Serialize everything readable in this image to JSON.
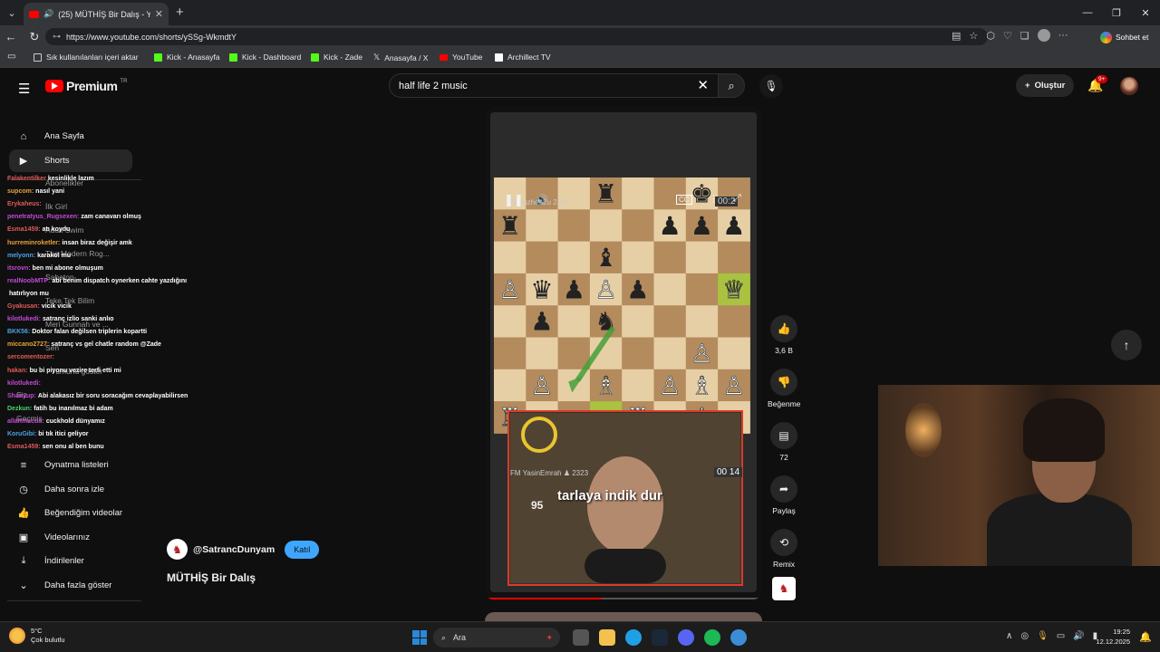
{
  "browser": {
    "tab_title": "(25) MÜTHİŞ Bir Dalış - YouTu",
    "url": "https://www.youtube.com/shorts/ySSg-WkmdtY",
    "chat_button": "Sohbet et",
    "bookmarks": [
      "Sık kullanılanları içeri aktar",
      "Kick - Anasayfa",
      "Kick - Dashboard",
      "Kick - Zade",
      "Anasayfa / X",
      "YouTube",
      "Archillect TV"
    ]
  },
  "youtube": {
    "logo_text": "Premium",
    "logo_region": "TR",
    "search_value": "half life 2 music",
    "create_label": "Oluştur",
    "notif_count": "9+"
  },
  "sidebar": {
    "top_items": [
      {
        "label": "Ana Sayfa",
        "icon": "home-icon"
      },
      {
        "label": "Shorts",
        "icon": "shorts-icon"
      }
    ],
    "behind_items": [
      "Abonelikler",
      "İlk Girl",
      "Adult Swim",
      "The Modern Rog...",
      "Sabaton",
      "Teke Tek Bilim",
      "Meri Gunnah ve ...",
      "Sen",
      "Tümünü göster",
      "Siz",
      "Geçmiş"
    ],
    "bottom_items": [
      {
        "label": "Oynatma listeleri",
        "icon": "playlist-icon"
      },
      {
        "label": "Daha sonra izle",
        "icon": "clock-icon"
      },
      {
        "label": "Beğendiğim videolar",
        "icon": "like-icon"
      },
      {
        "label": "Videolarınız",
        "icon": "video-icon"
      },
      {
        "label": "İndirilenler",
        "icon": "download-icon"
      },
      {
        "label": "Daha fazla göster",
        "icon": "chevron-down-icon"
      }
    ]
  },
  "chat_overlay": [
    {
      "user": "Falakentilker",
      "msg": "kesinlikle lazım",
      "color": "#e05a5a"
    },
    {
      "user": "supcom:",
      "msg": "nasıl yani",
      "color": "#e8a33a"
    },
    {
      "user": "Erykaheus:",
      "msg": "",
      "color": "#e05a5a"
    },
    {
      "user": "penetratyus_Rugsexen:",
      "msg": "zam canavarı olmuş",
      "color": "#c24ad6"
    },
    {
      "user": "Esma1459:",
      "msg": "atı koydu",
      "color": "#e05a5a"
    },
    {
      "user": "hurreminroketler:",
      "msg": "insan biraz değişir amk",
      "color": "#e8a33a"
    },
    {
      "user": "melyonn:",
      "msg": "karakol mu",
      "color": "#4aa3e8"
    },
    {
      "user": "itsrovn:",
      "msg": "ben mi abone olmuşum",
      "color": "#c24ad6"
    },
    {
      "user": "realNoobMTP:",
      "msg": "abi benim dispatch oynerken cahte yazdığını",
      "color": "#c24ad6"
    },
    {
      "user": "",
      "msg": "hatırlıyon mu",
      "color": "#ffffff"
    },
    {
      "user": "Gyakusan:",
      "msg": "vicik vicik",
      "color": "#e05a5a"
    },
    {
      "user": "kilotlukedi:",
      "msg": "satranç izlio sanki anlıo",
      "color": "#c24ad6"
    },
    {
      "user": "BKK56:",
      "msg": "Doktor falan değilsen triplerin kopartti",
      "color": "#4aa3e8"
    },
    {
      "user": "miccano2727:",
      "msg": "satranç vs gel chatle random @Zade",
      "color": "#e8a33a"
    },
    {
      "user": "sercomentozer:",
      "msg": "",
      "color": "#e05a5a"
    },
    {
      "user": "hakan:",
      "msg": "bu bi piyonu vezire terfi etti mi",
      "color": "#e05a5a"
    },
    {
      "user": "kilotlukedi:",
      "msg": "",
      "color": "#c24ad6"
    },
    {
      "user": "Shanyup:",
      "msg": "Abi alakasız bir soru soracağım cevaplayabilirsen",
      "color": "#c24ad6"
    },
    {
      "user": "Dezkun:",
      "msg": "fatih bu inanılmaz bi adam",
      "color": "#4ad66a"
    },
    {
      "user": "allahmacun:",
      "msg": "cuckhold dünyamız",
      "color": "#c24ad6"
    },
    {
      "user": "KoruGibi:",
      "msg": "bi tık itici geliyor",
      "color": "#4aa3e8"
    },
    {
      "user": "Esma1459:",
      "msg": "sen onu al ben bunu",
      "color": "#e05a5a"
    }
  ],
  "video": {
    "top_player": "Shenzhen2u 2311",
    "top_timer": "00:2",
    "bottom_player": "FM YasinEmrah",
    "bottom_rating": "2323",
    "bottom_timer": "00 14",
    "caption": "tarlaya indik dur",
    "gauge_value": "95",
    "channel": "@SatrancDunyam",
    "join_label": "Katıl",
    "title": "MÜTHİŞ Bir Dalış",
    "progress": 0.42
  },
  "board": {
    "rows": [
      [
        "",
        "",
        "",
        "r",
        "",
        "",
        "k",
        ""
      ],
      [
        "r",
        "",
        "",
        "",
        "",
        "p",
        "p",
        "p"
      ],
      [
        "",
        "",
        "",
        "b",
        "",
        "",
        "",
        ""
      ],
      [
        "P",
        "q",
        "p",
        "P",
        "p",
        "",
        "",
        "Q"
      ],
      [
        "",
        "p",
        "",
        "n",
        "",
        "",
        "",
        ""
      ],
      [
        "",
        "",
        "",
        "",
        "",
        "",
        "P",
        ""
      ],
      [
        "",
        "P",
        "",
        "B",
        "",
        "P",
        "B",
        "P"
      ],
      [
        "R",
        "",
        "",
        "",
        "R",
        "",
        "K",
        ""
      ]
    ],
    "highlight": [
      7,
      3
    ],
    "light": "#e7cfa5",
    "dark": "#b38b5d"
  },
  "actions": [
    {
      "name": "like",
      "icon": "thumbs-up-icon",
      "label": "3,6 B"
    },
    {
      "name": "dislike",
      "icon": "thumbs-down-icon",
      "label": "Beğenme"
    },
    {
      "name": "comments",
      "icon": "comment-icon",
      "label": "72"
    },
    {
      "name": "share",
      "icon": "share-icon",
      "label": "Paylaş"
    },
    {
      "name": "remix",
      "icon": "remix-icon",
      "label": "Remix"
    }
  ],
  "taskbar": {
    "temp": "5°C",
    "weather": "Çok bulutlu",
    "search": "Ara",
    "time": "19:25",
    "date": "12.12.2025"
  }
}
